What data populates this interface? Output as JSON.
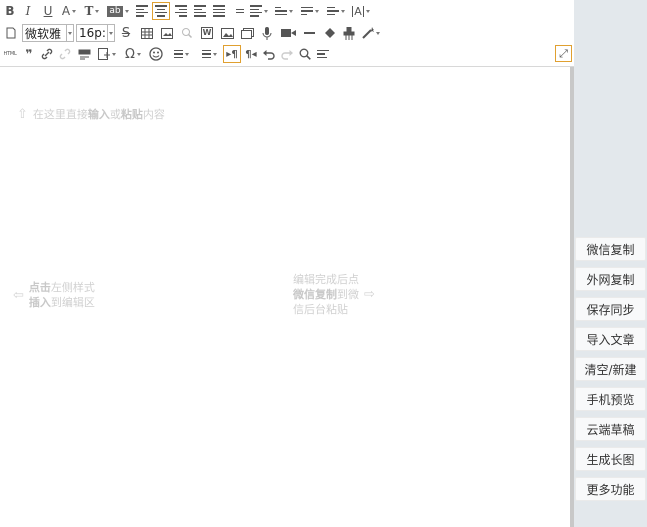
{
  "toolbar": {
    "font_family": "微软雅",
    "font_size": "16p:",
    "html_label": "HTML",
    "bold_label": "B",
    "italic_label": "I",
    "underline_label": "U",
    "fontcolor_label": "A",
    "fontsize_label": "T",
    "bgcolor_label": "ab",
    "omega_label": "Ω",
    "quote_label": "❞"
  },
  "editor": {
    "placeholder_top_pre": "在这里直接",
    "placeholder_top_b1": "输入",
    "placeholder_top_mid": "或",
    "placeholder_top_b2": "粘贴",
    "placeholder_top_post": "内容",
    "left_line1_b": "点击",
    "left_line1": "左侧样式",
    "left_line2_b": "插入",
    "left_line2": "到编辑区",
    "right_line1": "编辑完成后点",
    "right_line2_b": "微信复制",
    "right_line2": "到微",
    "right_line3": "信后台粘贴"
  },
  "side_panel": {
    "buttons": [
      "微信复制",
      "外网复制",
      "保存同步",
      "导入文章",
      "清空/新建",
      "手机预览",
      "云端草稿",
      "生成长图",
      "更多功能"
    ]
  },
  "colors": {
    "active_border": "#e0a030",
    "panel_bg": "#e3e8ec"
  }
}
